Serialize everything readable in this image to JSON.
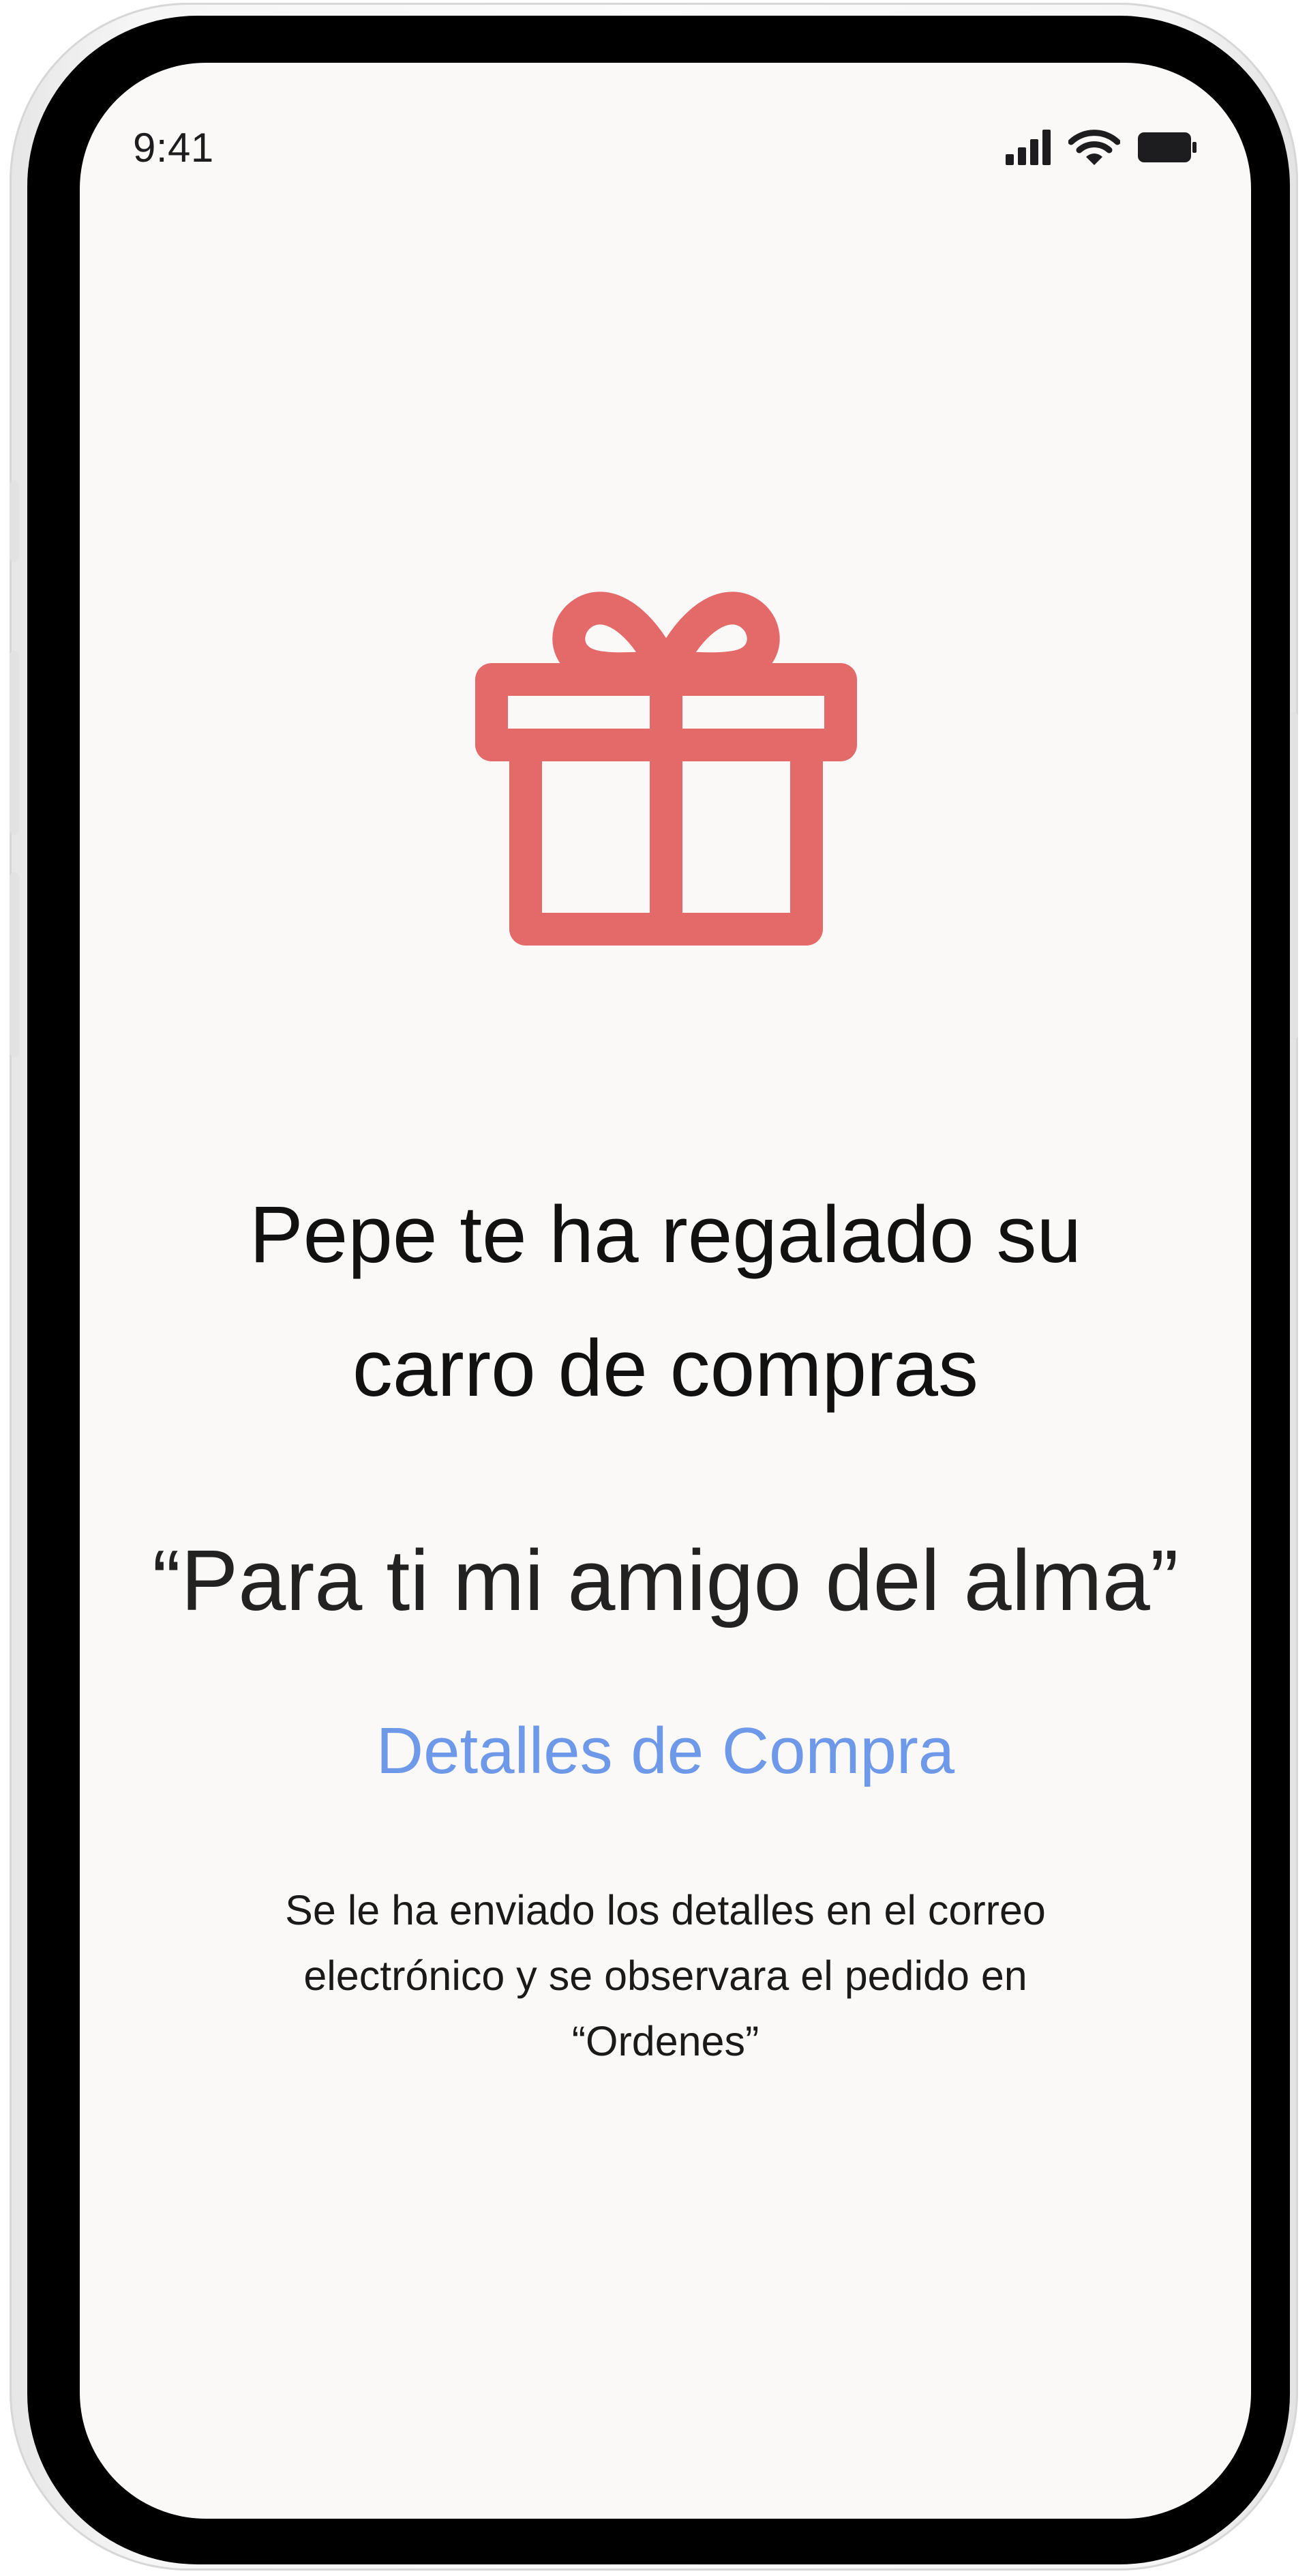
{
  "status_bar": {
    "time": "9:41",
    "icons": [
      "cellular-signal-icon",
      "wifi-icon",
      "battery-icon"
    ]
  },
  "gift": {
    "icon": "gift-icon",
    "color": "#e46a6a"
  },
  "message": {
    "title_line1": "Pepe te ha regalado su",
    "title_line2": "carro de compras",
    "quote": "“Para ti mi amigo del alma”",
    "details_link": "Detalles de Compra",
    "info_line1": "Se le ha enviado los detalles en el correo",
    "info_line2": "electrónico y se observara el pedido en",
    "info_line3": "“Ordenes”"
  },
  "colors": {
    "accent_link": "#6e99e8",
    "gift_red": "#e46a6a",
    "screen_bg": "#faf9f8"
  }
}
